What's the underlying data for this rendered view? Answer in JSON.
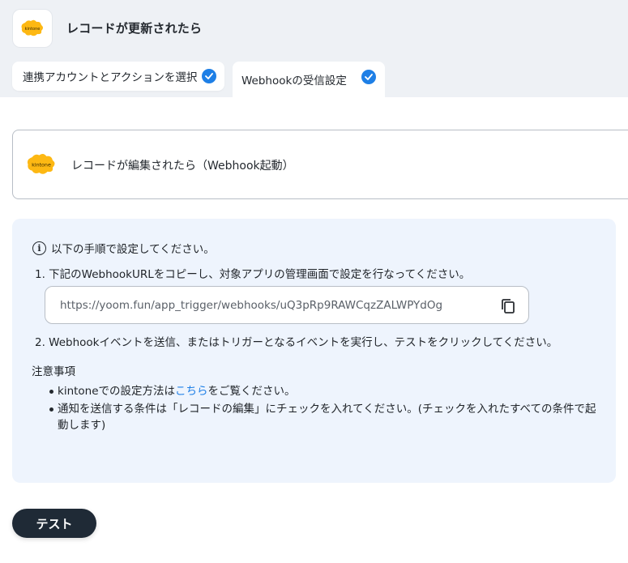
{
  "header": {
    "title": "レコードが更新されたら",
    "logo_text": "kintone"
  },
  "tabs": [
    {
      "label": "連携アカウントとアクションを選択",
      "completed": true
    },
    {
      "label": "Webhookの受信設定",
      "completed": true
    }
  ],
  "trigger": {
    "label": "レコードが編集されたら（Webhook起動）",
    "logo_text": "kintone"
  },
  "instructions": {
    "intro": "以下の手順で設定してください。",
    "step1": "1. 下記のWebhookURLをコピーし、対象アプリの管理画面で設定を行なってください。",
    "webhook_url": "https://yoom.fun/app_trigger/webhooks/uQ3pRp9RAWCqzZALWPYdOg",
    "step2": "2. Webhookイベントを送信、またはトリガーとなるイベントを実行し、テストをクリックしてください。",
    "notes_title": "注意事項",
    "note1_pre": "kintoneでの設定方法は",
    "note1_link": "こちら",
    "note1_post": "をご覧ください。",
    "note2": "通知を送信する条件は「レコードの編集」にチェックを入れてください。(チェックを入れたすべての条件で起動します)"
  },
  "actions": {
    "test_label": "テスト"
  },
  "colors": {
    "accent": "#1e7fe6",
    "panel_bg": "#eef4fd",
    "button_bg": "#1f2a36",
    "kintone_yellow": "#fdb813"
  }
}
